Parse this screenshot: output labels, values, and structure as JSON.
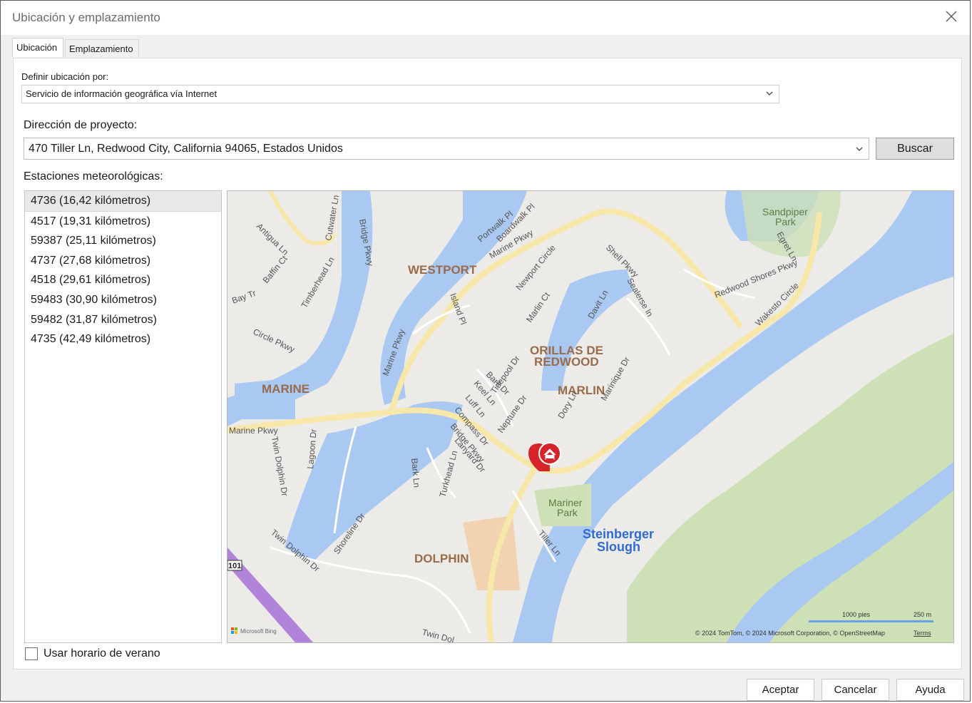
{
  "window": {
    "title": "Ubicación y emplazamiento"
  },
  "tabs": [
    {
      "label": "Ubicación"
    },
    {
      "label": "Emplazamiento"
    }
  ],
  "definir": {
    "label": "Definir ubicación por:",
    "value": "Servicio de información geográfica vía Internet"
  },
  "direccion": {
    "label": "Dirección de proyecto:",
    "value": "470 Tiller Ln, Redwood City, California 94065, Estados Unidos",
    "search_button": "Buscar"
  },
  "estaciones": {
    "label": "Estaciones meteorológicas:",
    "items": [
      "4736 (16,42 kilómetros)",
      "4517 (19,31 kilómetros)",
      "59387 (25,11 kilómetros)",
      "4737 (27,68 kilómetros)",
      "4518 (29,61 kilómetros)",
      "59483 (30,90 kilómetros)",
      "59482 (31,87 kilómetros)",
      "4735 (42,49 kilómetros)"
    ],
    "selected_index": 0
  },
  "map": {
    "areas": [
      "WESTPORT",
      "ORILLAS DE",
      "REDWOOD",
      "MARINE",
      "MARLIN",
      "DOLPHIN"
    ],
    "parks": [
      "Sandpiper",
      "Park",
      "Mariner",
      "Park"
    ],
    "water": [
      "Steinberger",
      "Slough"
    ],
    "streets": [
      "Antigua Ln",
      "Cutwater Ln",
      "Bridge Pkwy",
      "Portwalk Pl",
      "Boardwalk Pl",
      "Marine Pkwy",
      "Newport Circle",
      "Shell Pkwy",
      "Sealerse ln",
      "Egret Ln",
      "Redwood Shores Pkwy",
      "Wakesto Circle",
      "Bay Tr",
      "Baffin Ct",
      "Timberhead Ln",
      "Island Pl",
      "Marlin Ct",
      "Davit Ln",
      "Circle Pkwy",
      "Marine Pkwy",
      "Bark Dr",
      "Keel Ln",
      "Tidepool Dr",
      "Luff Ln",
      "Compass Dr",
      "Neptune Dr",
      "Dory Ln",
      "Marinique Dr",
      "Bridge Pkwy",
      "Lanyard Dr",
      "Marine Pkwy",
      "Twin Dolphin Dr",
      "Lagoon Dr",
      "Bark Ln",
      "Turkhead Ln",
      "Shoreline Dr",
      "Twin Dolphin Dr",
      "Tiller Ln",
      "Twin Dol"
    ],
    "highway": "101",
    "scale_feet": "1000 pies",
    "scale_m": "250 m",
    "attribution": "© 2024 TomTom, © 2024 Microsoft Corporation, © OpenStreetMap",
    "terms": "Terms",
    "brand": "Microsoft Bing"
  },
  "dst": {
    "label": "Usar horario de verano",
    "checked": false
  },
  "buttons": {
    "ok": "Aceptar",
    "cancel": "Cancelar",
    "help": "Ayuda"
  },
  "colors": {
    "water": "#a9c8f2",
    "land": "#ecebe7",
    "park": "#cde0b6",
    "road_major": "#f7e7a8",
    "pin": "#d7232a"
  }
}
